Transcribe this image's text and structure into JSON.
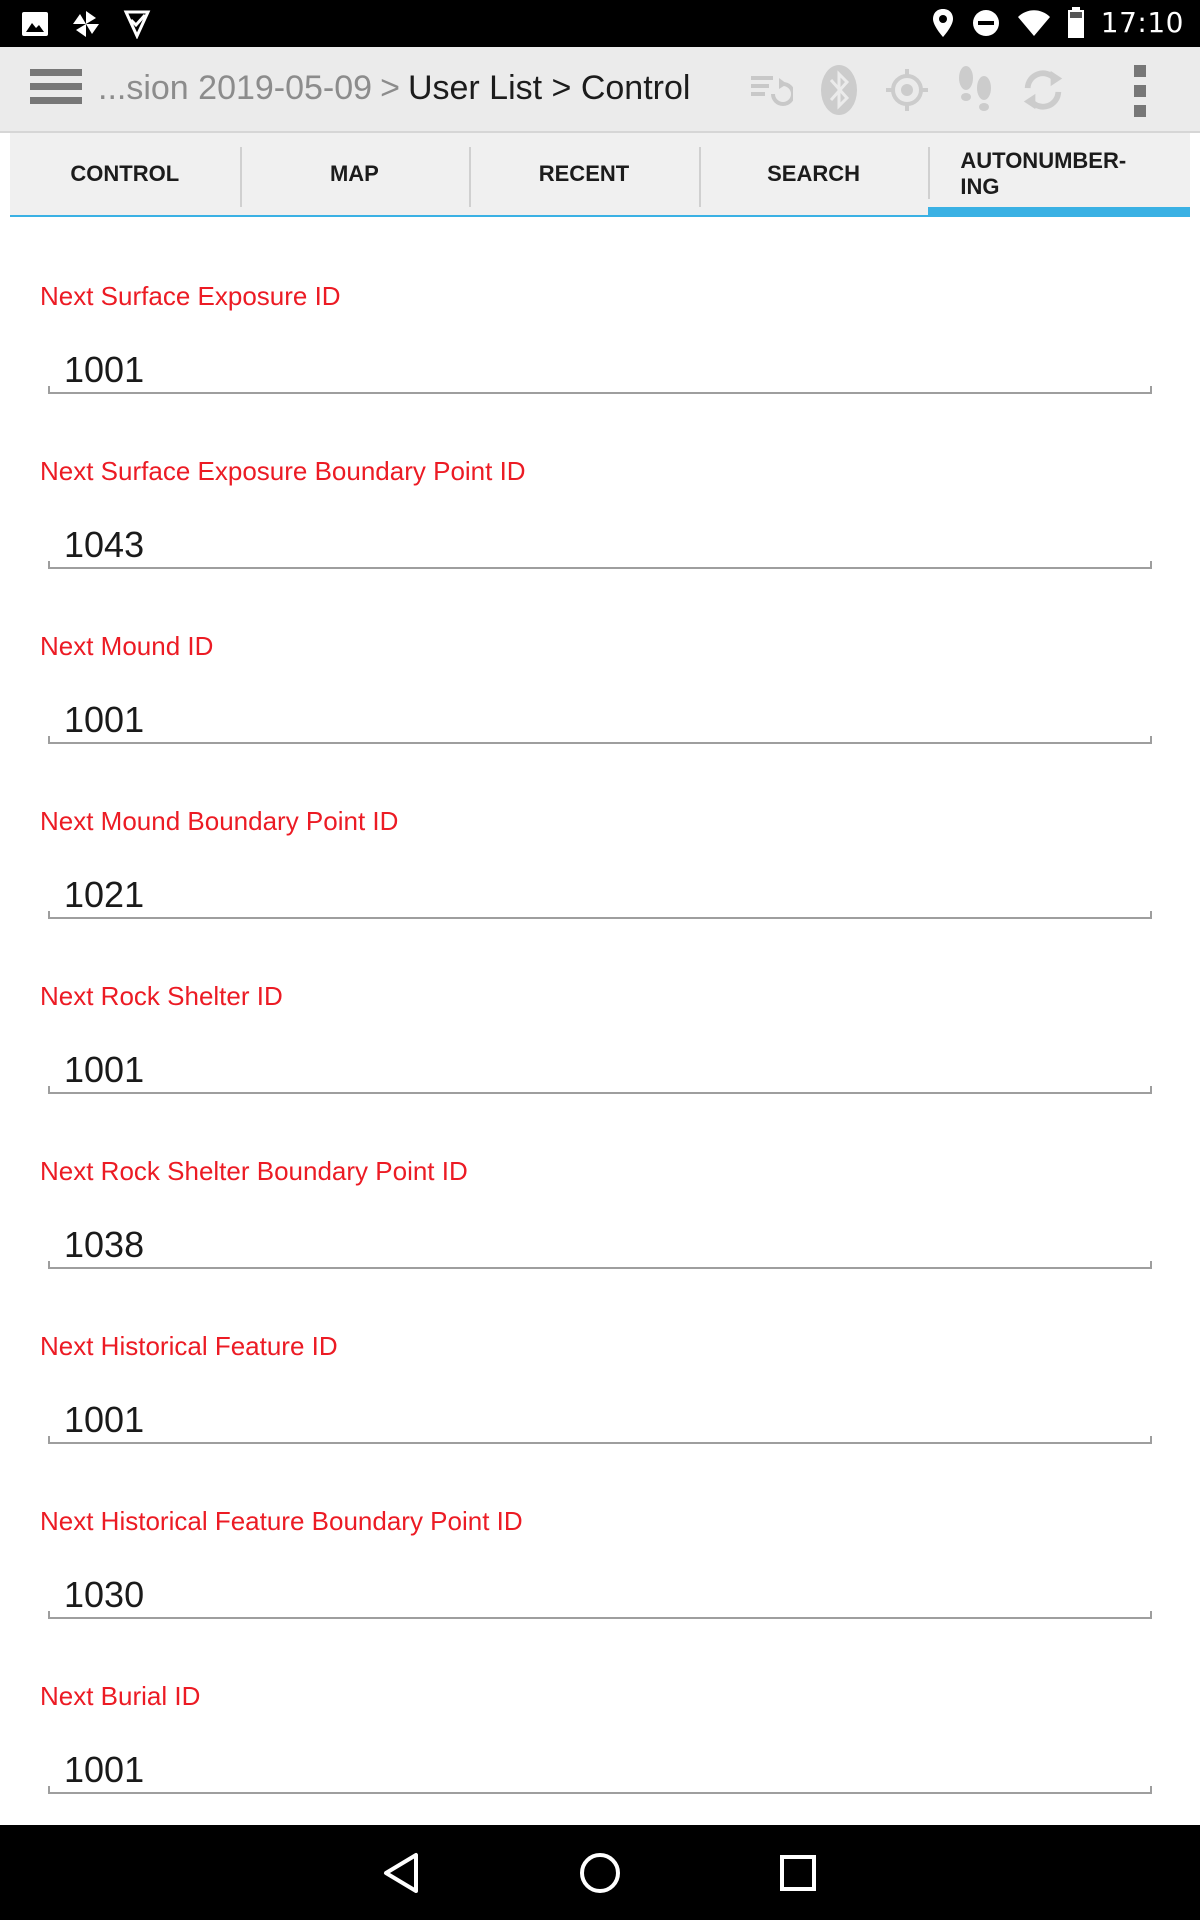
{
  "status_bar": {
    "time": "17:10",
    "left_icons": [
      "image-icon",
      "pinwheel-icon",
      "check-flag-icon"
    ],
    "right_icons": [
      "location-pin-icon",
      "do-not-disturb-icon",
      "wifi-icon",
      "battery-icon"
    ]
  },
  "action_bar": {
    "breadcrumb_prefix": "...sion 2019-05-09",
    "breadcrumb_sep": ">",
    "breadcrumb_current": "User List > Control",
    "icons": [
      "sync-list-icon",
      "bluetooth-icon",
      "gps-target-icon",
      "footsteps-icon",
      "refresh-icon"
    ]
  },
  "tabs": [
    {
      "label": "CONTROL",
      "active": false
    },
    {
      "label": "MAP",
      "active": false
    },
    {
      "label": "RECENT",
      "active": false
    },
    {
      "label": "SEARCH",
      "active": false
    },
    {
      "label": "AUTONUMBER-\nING",
      "active": true
    }
  ],
  "fields": [
    {
      "label": "Next Surface Exposure ID",
      "value": "1001"
    },
    {
      "label": "Next Surface Exposure Boundary Point ID",
      "value": "1043"
    },
    {
      "label": "Next Mound ID",
      "value": "1001"
    },
    {
      "label": "Next Mound Boundary Point ID",
      "value": "1021"
    },
    {
      "label": "Next Rock Shelter ID",
      "value": "1001"
    },
    {
      "label": "Next Rock Shelter Boundary Point ID",
      "value": "1038"
    },
    {
      "label": "Next Historical Feature ID",
      "value": "1001"
    },
    {
      "label": "Next Historical Feature Boundary Point ID",
      "value": "1030"
    },
    {
      "label": "Next Burial ID",
      "value": "1001"
    }
  ],
  "colors": {
    "label_red": "#ec1b24",
    "tab_accent": "#3ab1e4"
  },
  "nav_bar": {
    "icons": [
      "back-icon",
      "home-icon",
      "recents-icon"
    ]
  }
}
